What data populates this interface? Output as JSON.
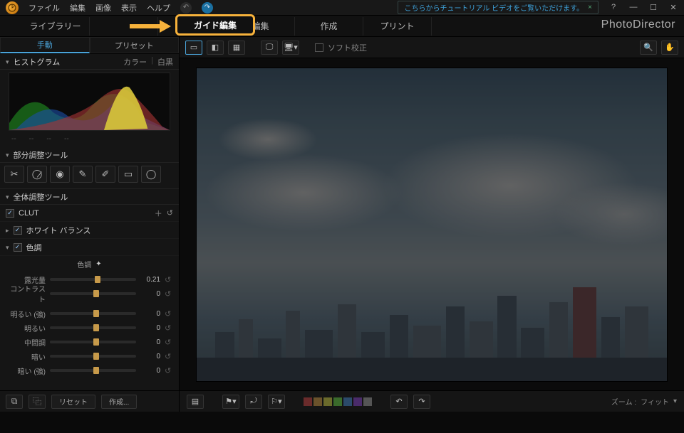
{
  "menu": {
    "file": "ファイル",
    "edit": "編集",
    "image": "画像",
    "view": "表示",
    "help": "ヘルプ"
  },
  "tutorial_banner": "こちらからチュートリアル ビデオをご覧いただけます。",
  "brand": "PhotoDirector",
  "modules": {
    "library": "ライブラリー",
    "guide": "ガイド編集",
    "edit": "編集",
    "create": "作成",
    "print": "プリント"
  },
  "subtabs": {
    "manual": "手動",
    "preset": "プリセット"
  },
  "histogram": {
    "title": "ヒストグラム",
    "modes": {
      "color": "カラー",
      "bw": "白黒"
    }
  },
  "mini_info": [
    "--",
    "--",
    "--",
    "--"
  ],
  "sections": {
    "local": "部分調整ツール",
    "global": "全体調整ツール"
  },
  "adj": {
    "clut": "CLUT",
    "wb": "ホワイト バランス",
    "tone": "色調"
  },
  "tone": {
    "heading": "色調",
    "sliders": [
      {
        "label": "露光量",
        "value": "0.21",
        "pos": 52
      },
      {
        "label": "コントラスト",
        "value": "0",
        "pos": 50
      },
      {
        "label": "明るい (強)",
        "value": "0",
        "pos": 50
      },
      {
        "label": "明るい",
        "value": "0",
        "pos": 50
      },
      {
        "label": "中間調",
        "value": "0",
        "pos": 50
      },
      {
        "label": "暗い",
        "value": "0",
        "pos": 50
      },
      {
        "label": "暗い (強)",
        "value": "0",
        "pos": 50
      }
    ]
  },
  "left_buttons": {
    "reset": "リセット",
    "create": "作成..."
  },
  "softproof": "ソフト校正",
  "swatch_colors": [
    "#6a2b2b",
    "#6a522b",
    "#6a6a2b",
    "#3a6a2b",
    "#2b4a6a",
    "#4a2b6a",
    "#555"
  ],
  "zoom": {
    "label": "ズーム :",
    "value": "フィット"
  }
}
